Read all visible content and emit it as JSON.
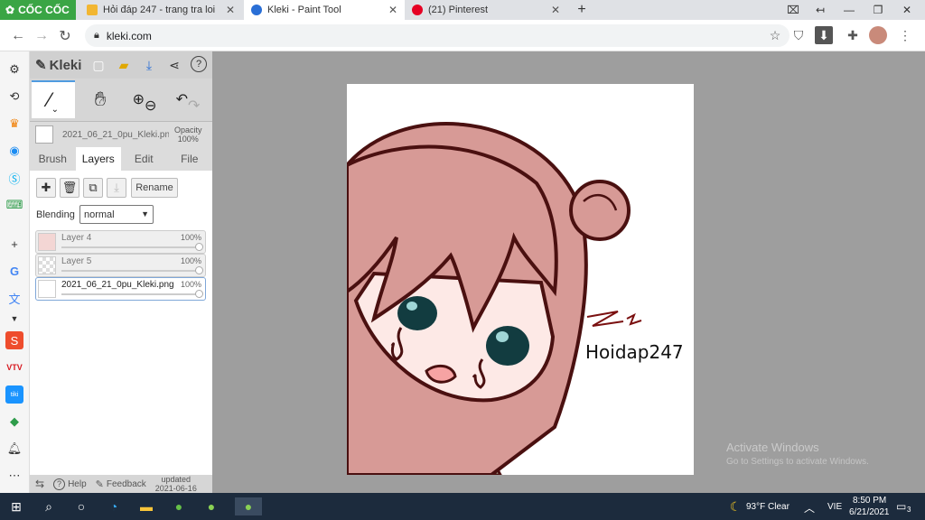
{
  "browser": {
    "brand": "CỐC CỐC",
    "tabs": [
      {
        "label": "Hỏi đáp 247 - trang tra loi",
        "active": false
      },
      {
        "label": "Kleki - Paint Tool",
        "active": true
      },
      {
        "label": "(21) Pinterest",
        "active": false
      }
    ],
    "new_tab": "+",
    "url": "kleki.com"
  },
  "kleki": {
    "logo": "Kleki",
    "file_name": "2021_06_21_0pu_Kleki.png",
    "opacity_label": "Opacity",
    "opacity_value": "100%",
    "tabs": [
      "Brush",
      "Layers",
      "Edit",
      "File"
    ],
    "active_tab": "Layers",
    "rename_label": "Rename",
    "blending_label": "Blending",
    "blending_value": "normal",
    "layers": [
      {
        "name": "Layer 4",
        "opacity": "100%"
      },
      {
        "name": "Layer 5",
        "opacity": "100%"
      },
      {
        "name": "2021_06_21_0pu_Kleki.png",
        "opacity": "100%"
      }
    ],
    "footer": {
      "help": "Help",
      "feedback": "Feedback",
      "updated_label": "updated",
      "updated_date": "2021-06-16"
    }
  },
  "canvas": {
    "signature_text": "Hoidap247"
  },
  "watermark": {
    "line1": "Activate Windows",
    "line2": "Go to Settings to activate Windows."
  },
  "taskbar": {
    "weather": "93°F  Clear",
    "lang": "VIE",
    "time": "8:50 PM",
    "date": "6/21/2021",
    "notifications": "3"
  },
  "colors": {
    "accent": "#4f9be0",
    "coccoc_green": "#3aa545",
    "hair": "#d79a96",
    "outline": "#4a1010"
  }
}
